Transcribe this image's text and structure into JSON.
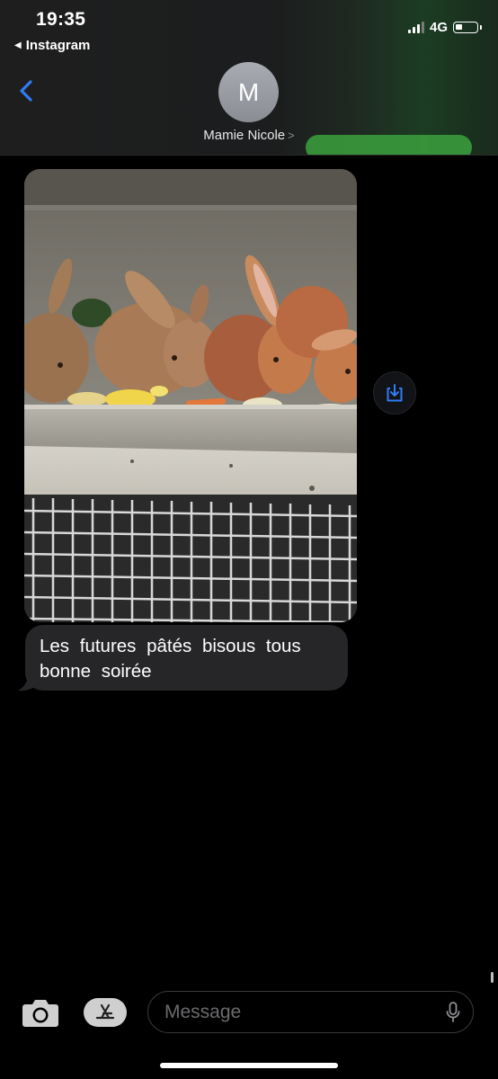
{
  "status_bar": {
    "time": "19:35",
    "back_app": "Instagram",
    "network": "4G",
    "signal_bars": 3,
    "battery_level": 0.25
  },
  "header": {
    "avatar_initial": "M",
    "contact_name": "Mamie Nicole",
    "back_icon": "chevron-left-icon",
    "accent": "#2f7cf6"
  },
  "conversation": {
    "photo_description_icon": "image",
    "save_icon": "download-icon",
    "message_text": "Les futures pâtés bisous tous bonne soirée"
  },
  "input_bar": {
    "placeholder": "Message",
    "value": "",
    "camera_icon": "camera-icon",
    "apps_icon": "app-store-icon",
    "mic_icon": "microphone-icon"
  }
}
